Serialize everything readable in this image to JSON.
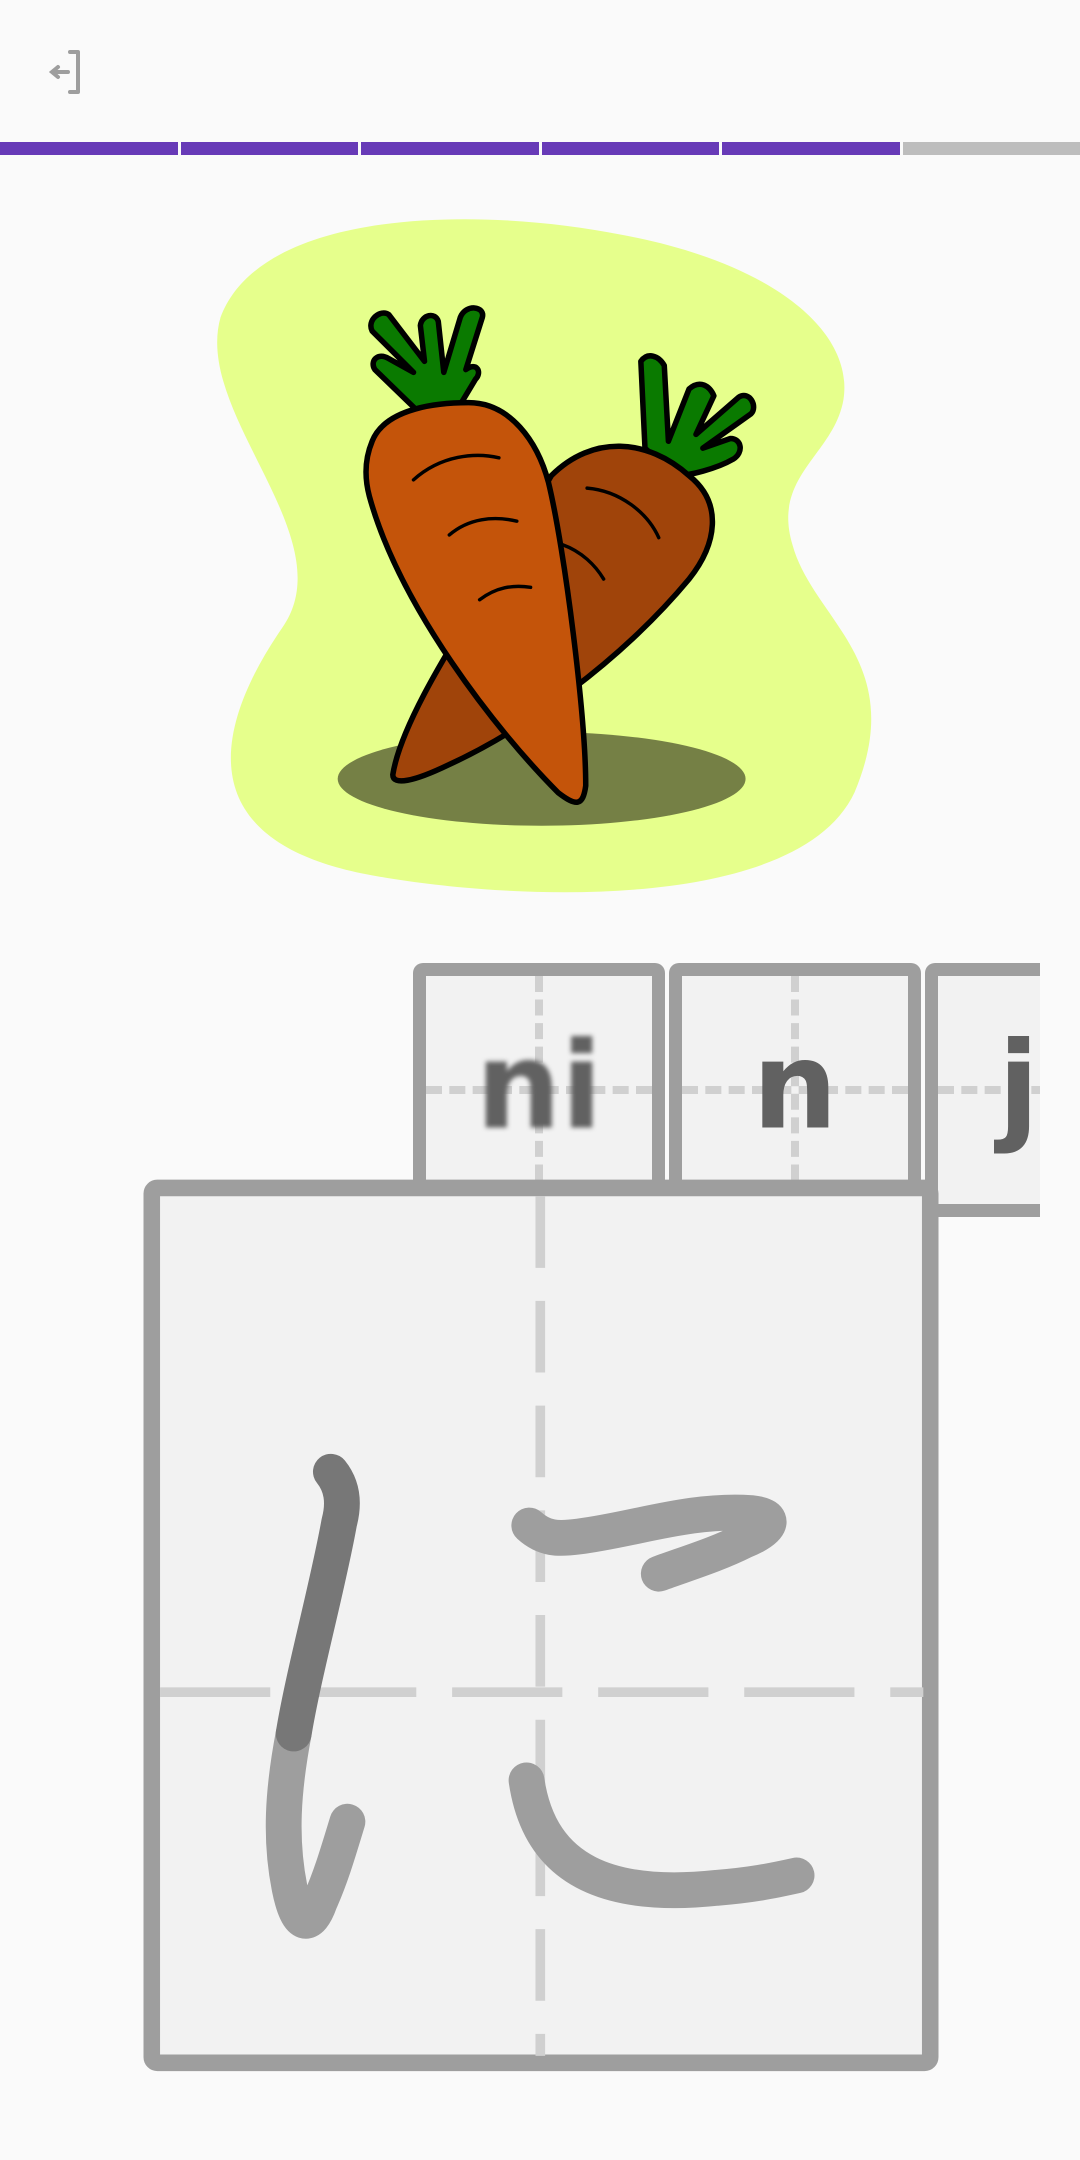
{
  "progress": {
    "completed_segments": 5,
    "total_segments": 6,
    "active_color": "#673ab7",
    "inactive_color": "#bdbdbd"
  },
  "illustration": {
    "subject": "carrots"
  },
  "answer_cards": [
    {
      "label": "ni",
      "state": "blurred"
    },
    {
      "label": "n",
      "state": "normal"
    },
    {
      "label": "j",
      "state": "partially-visible"
    }
  ],
  "drawing_pad": {
    "character": "に",
    "strokes_drawn": 3
  }
}
